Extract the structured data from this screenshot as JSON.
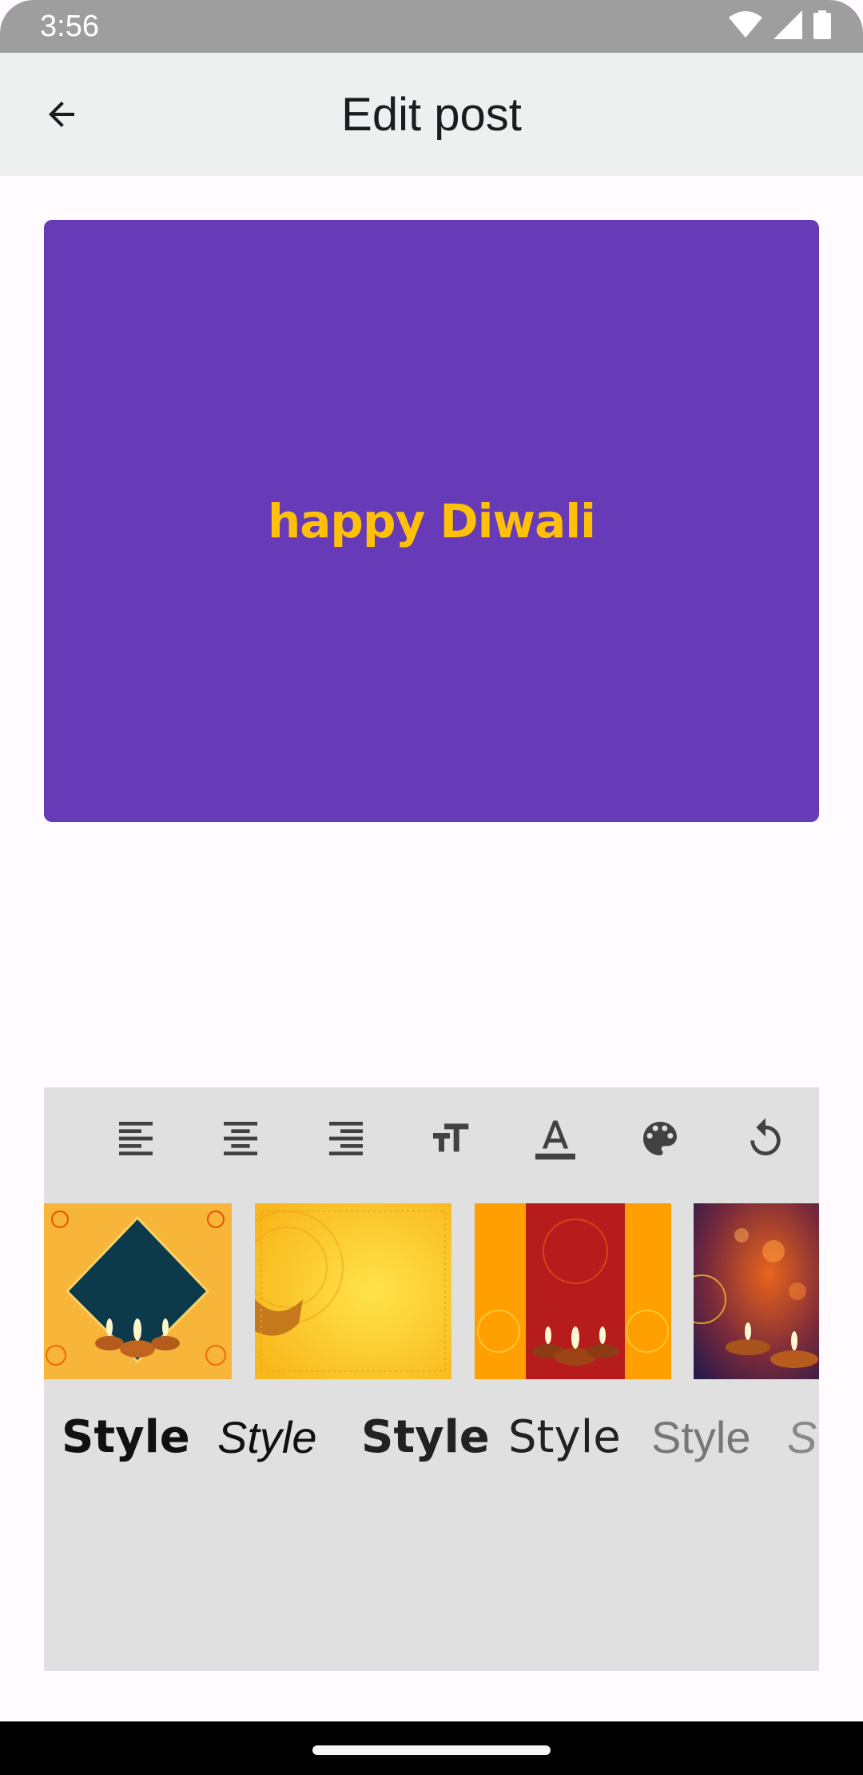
{
  "status_bar": {
    "time": "3:56",
    "icons": [
      "wifi-icon",
      "signal-icon",
      "battery-icon"
    ]
  },
  "app_bar": {
    "title": "Edit post",
    "back_icon": "arrow-back-icon"
  },
  "post": {
    "text": "happy Diwali",
    "background_color": "#673ab7",
    "text_color": "#ffc107"
  },
  "toolbar": {
    "tools": [
      {
        "name": "align-left-icon"
      },
      {
        "name": "align-center-icon"
      },
      {
        "name": "align-right-icon"
      },
      {
        "name": "text-size-icon"
      },
      {
        "name": "text-color-icon",
        "glyph": "A"
      },
      {
        "name": "palette-icon"
      },
      {
        "name": "reset-icon"
      }
    ]
  },
  "backgrounds": [
    {
      "name": "diwali-diya-diamond-background"
    },
    {
      "name": "diwali-yellow-mandala-background"
    },
    {
      "name": "diwali-red-orange-diya-background"
    },
    {
      "name": "diwali-purple-bokeh-background"
    }
  ],
  "font_styles": [
    {
      "label": "Style",
      "font": "bold"
    },
    {
      "label": "Style",
      "font": "italic"
    },
    {
      "label": "Style",
      "font": "semibold"
    },
    {
      "label": "Style",
      "font": "regular"
    },
    {
      "label": "Style",
      "font": "light"
    },
    {
      "label": "St",
      "font": "light-italic"
    }
  ],
  "colors": {
    "status_bar": "#9e9e9e",
    "app_bar": "#eef0ef",
    "panel": "#e0e0e0",
    "icon": "#424242"
  }
}
